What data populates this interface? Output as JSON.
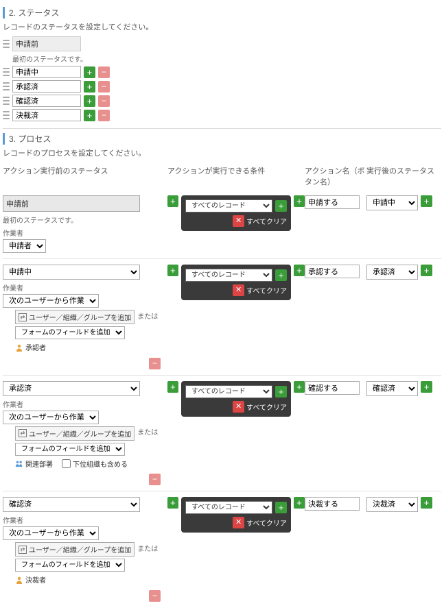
{
  "section2": {
    "title": "2. ステータス",
    "desc": "レコードのステータスを設定してください。",
    "first_status": "申請前",
    "first_note": "最初のステータスです。",
    "statuses": [
      "申請中",
      "承認済",
      "確認済",
      "決裁済"
    ]
  },
  "section3": {
    "title": "3. プロセス",
    "desc": "レコードのプロセスを設定してください。",
    "headers": {
      "before": "アクション実行前のステータス",
      "cond": "アクションが実行できる条件",
      "action": "アクション名（ボタン名）",
      "after": "実行後のステータス"
    },
    "cond_label": "すべてのレコード",
    "clear_label": "すべてクリア",
    "worker_label": "作業者",
    "worker_select_label": "次のユーザーから作業者を選択",
    "org_btn_label": "ユーザー／組織／グループを追加",
    "field_select_label": "フォームのフィールドを追加",
    "or_text": "または",
    "sub_org_label": "下位組織も含める",
    "rows": [
      {
        "before": "申請前",
        "before_readonly": true,
        "first_note": "最初のステータスです。",
        "worker_simple": "申請者",
        "action": "申請する",
        "after": "申請中"
      },
      {
        "before": "申請中",
        "user": "承認者",
        "user_icon": "person",
        "action": "承認する",
        "after": "承認済"
      },
      {
        "before": "承認済",
        "user": "関連部署",
        "user_icon": "group",
        "show_suborg": true,
        "action": "確認する",
        "after": "確認済"
      },
      {
        "before": "確認済",
        "user": "決裁者",
        "user_icon": "person",
        "action": "決裁する",
        "after": "決裁済"
      }
    ]
  }
}
